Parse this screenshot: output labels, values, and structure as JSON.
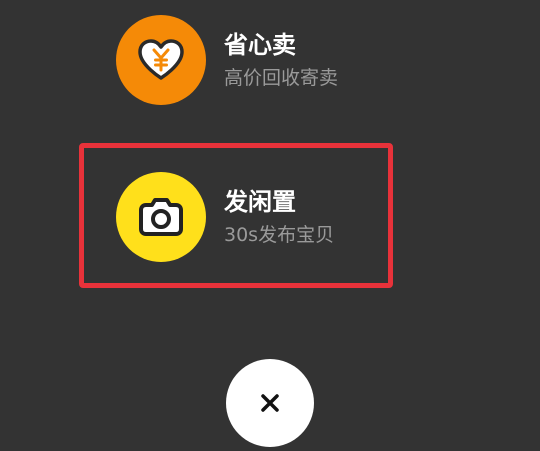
{
  "menu": {
    "options": [
      {
        "title": "省心卖",
        "subtitle": "高价回收寄卖",
        "icon": "heart-yen-icon",
        "icon_bg": "#F58A07"
      },
      {
        "title": "发闲置",
        "subtitle": "30s发布宝贝",
        "icon": "camera-icon",
        "icon_bg": "#FFE01B"
      }
    ],
    "highlight_color": "#E8323A",
    "close": {
      "icon": "close-icon"
    }
  },
  "colors": {
    "background": "#333333",
    "title_text": "#FFFFFF",
    "subtitle_text": "#9A9A9A"
  }
}
